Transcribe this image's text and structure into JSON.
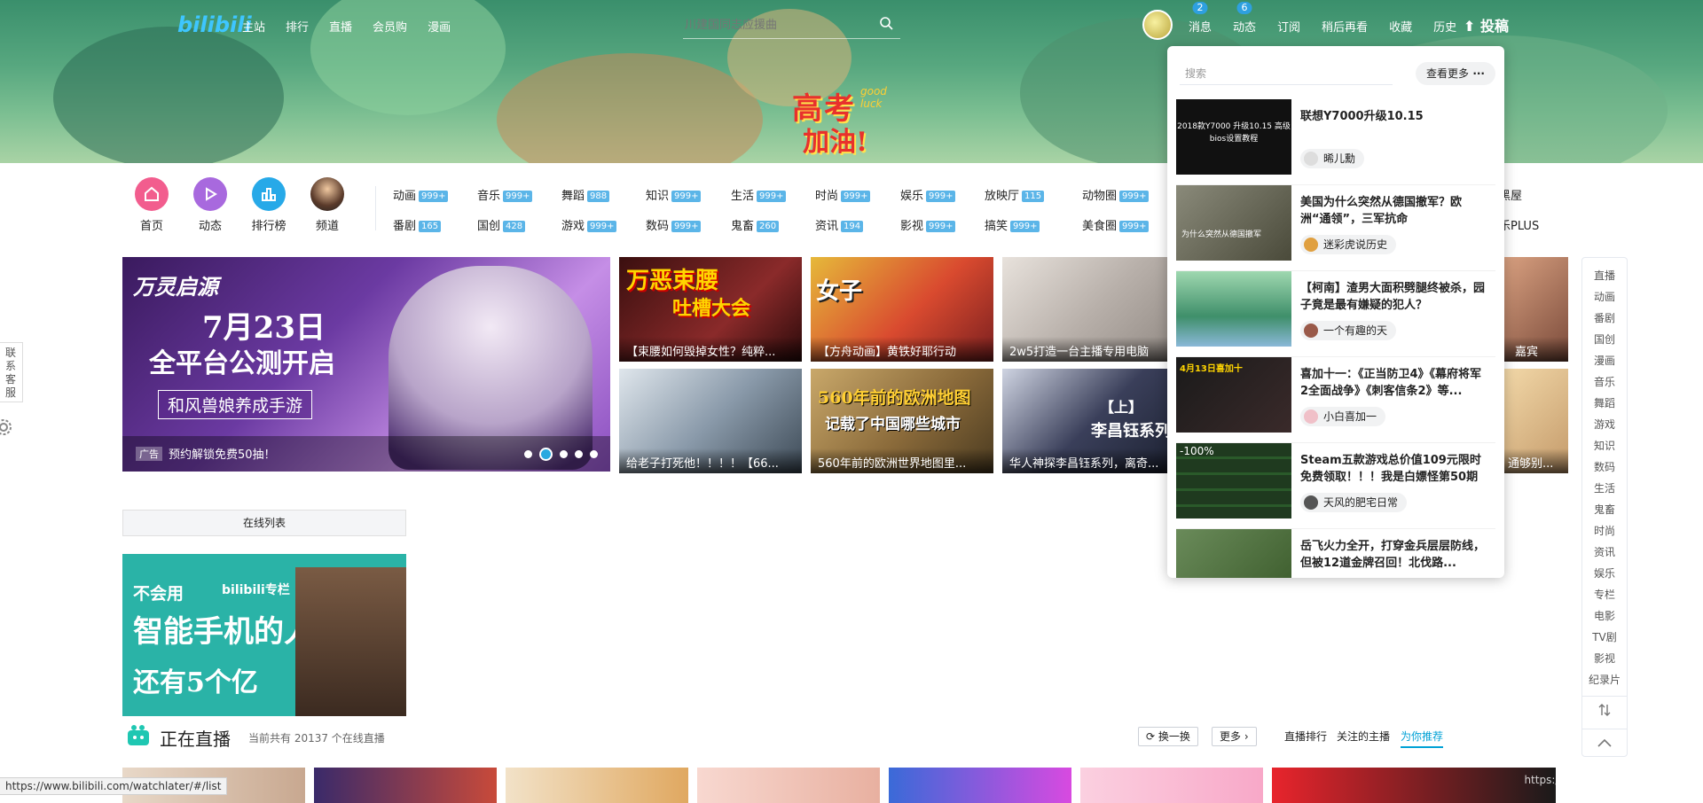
{
  "header": {
    "logo": "bilibili",
    "nav": [
      "主站",
      "排行",
      "直播",
      "会员购",
      "漫画"
    ],
    "search_placeholder": "川建国同志应援曲",
    "right_nav": [
      {
        "label": "消息",
        "badge": "2"
      },
      {
        "label": "动态",
        "badge": "6"
      },
      {
        "label": "订阅",
        "badge": ""
      },
      {
        "label": "稍后再看",
        "badge": ""
      },
      {
        "label": "收藏",
        "badge": ""
      },
      {
        "label": "历史",
        "badge": ""
      }
    ],
    "upload": "投稿"
  },
  "banner": {
    "line1": "高考",
    "line2": "加油!",
    "luck1": "good",
    "luck2": "luck"
  },
  "primary": [
    {
      "label": "首页",
      "color": "#f25d8e"
    },
    {
      "label": "动态",
      "color": "#a869de"
    },
    {
      "label": "排行榜",
      "color": "#27a9e8"
    },
    {
      "label": "频道",
      "color": "#333333"
    }
  ],
  "categories": [
    {
      "name": "动画",
      "count": "999+"
    },
    {
      "name": "音乐",
      "count": "999+"
    },
    {
      "name": "舞蹈",
      "count": "988"
    },
    {
      "name": "知识",
      "count": "999+"
    },
    {
      "name": "生活",
      "count": "999+"
    },
    {
      "name": "时尚",
      "count": "999+"
    },
    {
      "name": "娱乐",
      "count": "999+"
    },
    {
      "name": "放映厅",
      "count": "115"
    },
    {
      "name": "动物圈",
      "count": "999+"
    },
    {
      "name": "番剧",
      "count": "165"
    },
    {
      "name": "国创",
      "count": "428"
    },
    {
      "name": "游戏",
      "count": "999+"
    },
    {
      "name": "数码",
      "count": "999+"
    },
    {
      "name": "鬼畜",
      "count": "260"
    },
    {
      "name": "资讯",
      "count": "194"
    },
    {
      "name": "影视",
      "count": "999+"
    },
    {
      "name": "搞笑",
      "count": "999+"
    },
    {
      "name": "美食圈",
      "count": "999+"
    }
  ],
  "cat_extra": [
    "黑屋",
    "乐PLUS"
  ],
  "carousel": {
    "brand": "万灵启源",
    "title1": "7月23日",
    "title2": "全平台公测开启",
    "tag": "和风兽娘养成手游",
    "ad": "广告",
    "caption": "预约解锁免费50抽！",
    "active_dot": 1,
    "dot_count": 5
  },
  "tiles": [
    {
      "caption": "【束腰如何毁掉女性？纯粹...",
      "big": "万恶束腰",
      "big2": "吐槽大会",
      "color": "#7a1f1f"
    },
    {
      "caption": "【方舟动画】黄铁好耶行动",
      "big": "女子",
      "big2": "",
      "color": "#d94a2f"
    },
    {
      "caption": "2w5打造一台主播专用电脑",
      "big": "",
      "big2": "",
      "color": "#c9c2bd"
    },
    {
      "caption": "给老子打死他！！！！【66...",
      "big": "",
      "big2": "",
      "color": "#5a6a7a"
    },
    {
      "caption": "560年前的欧洲世界地图里...",
      "big": "560年前的欧洲地图",
      "big2": "记载了中国哪些城市",
      "color": "#8a6a3a"
    },
    {
      "caption": "华人神探李昌钰系列，离奇...",
      "big": "【上】",
      "big2": "李昌钰系列",
      "color": "#3a3f5a"
    }
  ],
  "tile_partial": [
    "嘉宾",
    "通够别..."
  ],
  "online_list": "在线列表",
  "promo": {
    "p1": "不会用",
    "brand": "bilibili专栏",
    "p2": "智能手机的人",
    "p3": "还有5个亿"
  },
  "live": {
    "title": "正在直播",
    "count_text": "当前共有 20137 个在线直播",
    "refresh": "换一换",
    "more": "更多",
    "tabs": [
      "直播排行",
      "关注的主播",
      "为你推荐"
    ],
    "active_tab": 2
  },
  "side_nav": [
    "直播",
    "动画",
    "番剧",
    "国创",
    "漫画",
    "音乐",
    "舞蹈",
    "游戏",
    "知识",
    "数码",
    "生活",
    "鬼畜",
    "时尚",
    "资讯",
    "娱乐",
    "专栏",
    "电影",
    "TV剧",
    "影视",
    "纪录片"
  ],
  "left_tab": "联系客服",
  "status_url": "https://www.bilibili.com/watchlater/#/list",
  "watermark": "https://blog.csdn.net/joey_ro",
  "watch_later": {
    "search_placeholder": "搜索",
    "more": "查看更多",
    "items": [
      {
        "title": "联想Y7000升级10.15",
        "up": "晞儿勳",
        "thumb_text": "2018款Y7000 升级10.15 高级bios设置教程",
        "color": "#111111"
      },
      {
        "title": "美国为什么突然从德国撤军？欧洲“通领”，三军抗命",
        "up": "迷彩虎说历史",
        "thumb_text": "为什么突然从德国撤军",
        "color": "#6b6b5a"
      },
      {
        "title": "【柯南】渣男大面积劈腿终被杀，园子竟是最有嫌疑的犯人？",
        "up": "一个有趣的天",
        "thumb_text": "",
        "color": "#3f8f6a"
      },
      {
        "title": "喜加十一：《正当防卫4》《幕府将军2全面战争》《刺客信条2》等...",
        "up": "小白喜加一",
        "thumb_text": "4月13日喜加十",
        "color": "#1a1a1a"
      },
      {
        "title": "Steam五款游戏总价值109元限时免费领取！！！我是白嫖怪第50期",
        "up": "天风的肥宅日常",
        "thumb_text": "-100%",
        "color": "#1f3a1f"
      },
      {
        "title": "岳飞火力全开，打穿金兵层层防线，但被12道金牌召回！北伐路...",
        "up": "",
        "thumb_text": "",
        "color": "#4a6b3a"
      }
    ]
  }
}
